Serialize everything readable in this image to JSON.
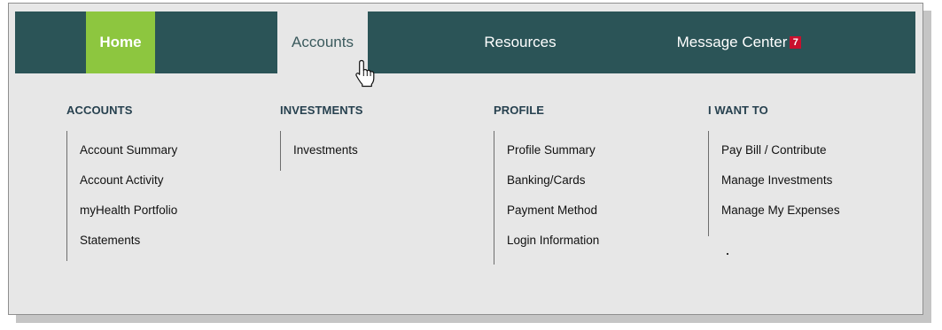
{
  "nav": {
    "home": "Home",
    "accounts": "Accounts",
    "resources": "Resources",
    "message_center": "Message Center",
    "message_count": "7"
  },
  "menu": {
    "accounts": {
      "heading": "ACCOUNTS",
      "links": [
        "Account Summary",
        "Account Activity",
        "myHealth Portfolio",
        "Statements"
      ]
    },
    "investments": {
      "heading": "INVESTMENTS",
      "links": [
        "Investments"
      ]
    },
    "profile": {
      "heading": "PROFILE",
      "links": [
        "Profile Summary",
        "Banking/Cards",
        "Payment Method",
        "Login Information"
      ]
    },
    "i_want_to": {
      "heading": "I WANT TO",
      "links": [
        "Pay Bill / Contribute",
        "Manage Investments",
        "Manage My Expenses"
      ]
    }
  },
  "colors": {
    "navbar": "#2b5457",
    "home_tab": "#8dc63f",
    "active_tab": "#e7e7e7",
    "badge": "#c8102e"
  },
  "icons": {
    "cursor": "hand-pointer-icon"
  }
}
